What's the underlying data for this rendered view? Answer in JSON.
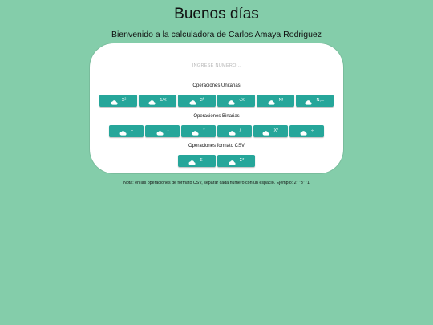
{
  "header": {
    "title": "Buenos días",
    "subtitle": "Bienvenido a la calculadora de Carlos Amaya Rodriguez"
  },
  "input": {
    "placeholder": "INGRESE NUMERO..."
  },
  "unitary": {
    "label": "Operaciones Unitarias",
    "buttons": [
      {
        "base": "X",
        "sup": "2"
      },
      {
        "base": "1/X",
        "sup": ""
      },
      {
        "base": "2",
        "sup": "N"
      },
      {
        "base": "√X",
        "sup": ""
      },
      {
        "base": "N!",
        "sup": ""
      },
      {
        "base": "N,...",
        "sup": ""
      }
    ]
  },
  "binary": {
    "label": "Operaciones Binarias",
    "buttons": [
      {
        "base": "+",
        "sup": ""
      },
      {
        "base": "-",
        "sup": ""
      },
      {
        "base": "*",
        "sup": ""
      },
      {
        "base": "/",
        "sup": ""
      },
      {
        "base": "X",
        "sup": "Y"
      },
      {
        "base": "÷",
        "sup": ""
      }
    ]
  },
  "csv": {
    "label": "Operaciones formato CSV",
    "buttons": [
      {
        "base": "Σ+",
        "sup": ""
      },
      {
        "base": "Σ*",
        "sup": ""
      }
    ]
  },
  "note": "Nota: en las operaciones de formato CSV, separar cada numero con un espacio. Ejemplo: 2\" \"3\" \"1",
  "icon": "cloud-icon",
  "colors": {
    "background": "#84cdaa",
    "card": "#ffffff",
    "button": "#26a69a"
  }
}
